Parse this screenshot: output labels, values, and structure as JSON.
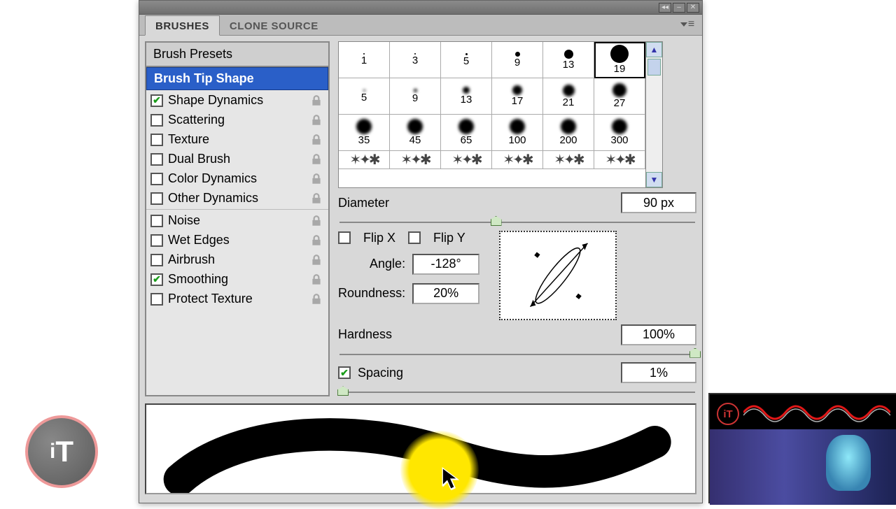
{
  "tabs": {
    "brushes": "BRUSHES",
    "clone": "CLONE SOURCE"
  },
  "sidebar": {
    "header": "Brush Presets",
    "selected": "Brush Tip Shape",
    "items": [
      {
        "label": "Shape Dynamics",
        "checked": true,
        "lock": true
      },
      {
        "label": "Scattering",
        "checked": false,
        "lock": true
      },
      {
        "label": "Texture",
        "checked": false,
        "lock": true
      },
      {
        "label": "Dual Brush",
        "checked": false,
        "lock": true
      },
      {
        "label": "Color Dynamics",
        "checked": false,
        "lock": true
      },
      {
        "label": "Other Dynamics",
        "checked": false,
        "lock": true
      },
      {
        "label": "Noise",
        "checked": false,
        "lock": true,
        "sep": true
      },
      {
        "label": "Wet Edges",
        "checked": false,
        "lock": true
      },
      {
        "label": "Airbrush",
        "checked": false,
        "lock": true
      },
      {
        "label": "Smoothing",
        "checked": true,
        "lock": true
      },
      {
        "label": "Protect Texture",
        "checked": false,
        "lock": true
      }
    ]
  },
  "brush_sizes": {
    "row1": [
      "1",
      "3",
      "5",
      "9",
      "13",
      "19"
    ],
    "row2": [
      "5",
      "9",
      "13",
      "17",
      "21",
      "27"
    ],
    "row3": [
      "35",
      "45",
      "65",
      "100",
      "200",
      "300"
    ]
  },
  "fields": {
    "diameter_label": "Diameter",
    "diameter_value": "90 px",
    "flipx": "Flip X",
    "flipy": "Flip Y",
    "angle_label": "Angle:",
    "angle_value": "-128°",
    "round_label": "Roundness:",
    "round_value": "20%",
    "hardness_label": "Hardness",
    "hardness_value": "100%",
    "spacing_label": "Spacing",
    "spacing_value": "1%"
  },
  "sliders": {
    "diameter_pct": 44,
    "hardness_pct": 100,
    "spacing_pct": 0
  },
  "watermark": {
    "text": "iT"
  },
  "colors": {
    "accent": "#2a5fc8",
    "check": "#1a9c1a"
  }
}
